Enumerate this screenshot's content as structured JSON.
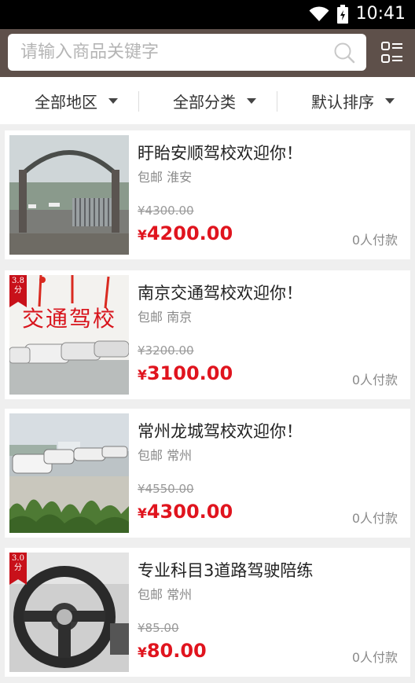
{
  "status_bar": {
    "time": "10:41"
  },
  "search": {
    "placeholder": "请输入商品关键字"
  },
  "filters": [
    {
      "label": "全部地区"
    },
    {
      "label": "全部分类"
    },
    {
      "label": "默认排序"
    }
  ],
  "listings": [
    {
      "title": "盱眙安顺驾校欢迎你！",
      "shipping": "包邮",
      "location": "淮安",
      "original_price": "¥4300.00",
      "currency": "¥",
      "price": "4200.00",
      "paid_count": "0人付款"
    },
    {
      "title": "南京交通驾校欢迎你！",
      "shipping": "包邮",
      "location": "南京",
      "original_price": "¥3200.00",
      "currency": "¥",
      "price": "3100.00",
      "paid_count": "0人付款",
      "badge": {
        "score": "3.8",
        "unit": "分"
      },
      "banner_text": "交通驾校"
    },
    {
      "title": "常州龙城驾校欢迎你！",
      "shipping": "包邮",
      "location": "常州",
      "original_price": "¥4550.00",
      "currency": "¥",
      "price": "4300.00",
      "paid_count": "0人付款"
    },
    {
      "title": "专业科目3道路驾驶陪练",
      "shipping": "包邮",
      "location": "常州",
      "original_price": "¥85.00",
      "currency": "¥",
      "price": "80.00",
      "paid_count": "0人付款",
      "badge": {
        "score": "3.0",
        "unit": "分"
      }
    }
  ],
  "colors": {
    "header": "#5e504a",
    "price": "#e0141e",
    "badge": "#c8111a"
  }
}
